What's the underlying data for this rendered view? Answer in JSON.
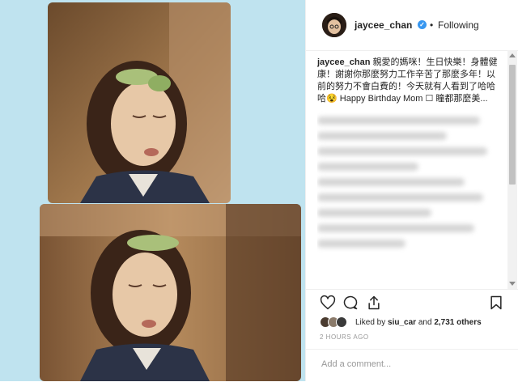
{
  "post": {
    "username": "jaycee_chan",
    "verified_mark": "✓",
    "separator": "•",
    "follow_status": "Following",
    "caption_user": "jaycee_chan",
    "caption_text": "親愛的媽咪！生日快樂！身體健康！謝謝你那麼努力工作辛苦了那麼多年！以前的努力不會白費的！今天就有人看到了哈哈哈😵 Happy Birthday Mom ☐ 瞳都那麼美...",
    "likes_prefix": "Liked by",
    "likes_user": "siu_car",
    "likes_conjunction": "and",
    "likes_count": "2,731 others",
    "timestamp": "2 HOURS AGO",
    "comment_placeholder": "Add a comment..."
  },
  "icons": {
    "like": "heart-icon",
    "comment": "comment-icon",
    "share": "share-icon",
    "save": "bookmark-icon"
  },
  "colors": {
    "photo_background": "#bfe3ef",
    "verified_blue": "#3897f0",
    "muted_text": "#999999"
  }
}
